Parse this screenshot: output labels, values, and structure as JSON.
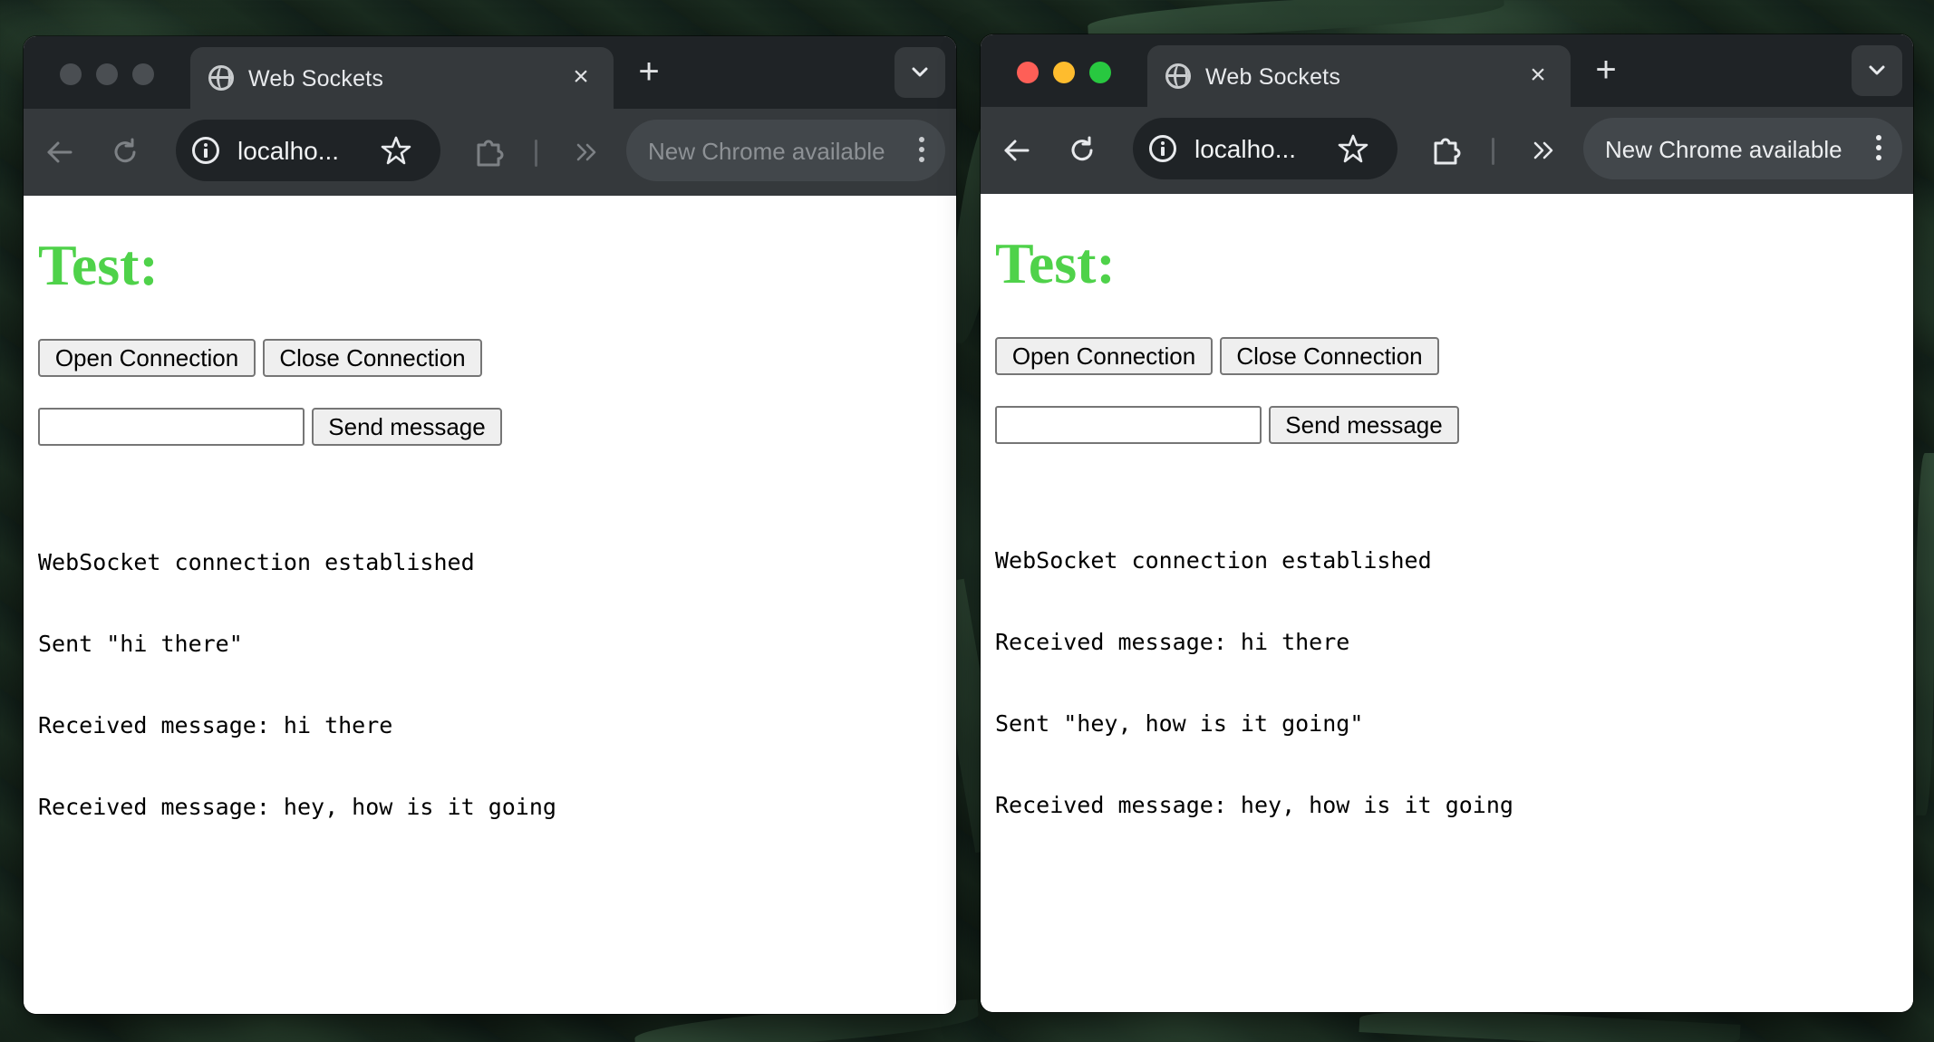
{
  "windows": [
    {
      "state": "inactive",
      "tab_title": "Web Sockets",
      "url": "localho...",
      "update_text": "New Chrome available",
      "heading": "Test:",
      "open_label": "Open Connection",
      "close_label": "Close Connection",
      "input_value": "",
      "send_label": "Send message",
      "log": [
        "WebSocket connection established",
        "Sent \"hi there\"",
        "Received message: hi there",
        "Received message: hey, how is it going"
      ]
    },
    {
      "state": "active",
      "tab_title": "Web Sockets",
      "url": "localho...",
      "update_text": "New Chrome available",
      "heading": "Test:",
      "open_label": "Open Connection",
      "close_label": "Close Connection",
      "input_value": "",
      "send_label": "Send message",
      "log": [
        "WebSocket connection established",
        "Received message: hi there",
        "Sent \"hey, how is it going\"",
        "Received message: hey, how is it going"
      ]
    }
  ],
  "icons": {
    "globe": "globe-icon",
    "close": "close-icon",
    "new_tab": "plus-icon",
    "dropdown": "chevron-down-icon",
    "back": "arrow-left-icon",
    "reload": "reload-icon",
    "info": "info-icon",
    "bookmark": "star-icon",
    "extensions": "puzzle-icon",
    "more": "double-chevron-right-icon",
    "menu": "kebab-icon"
  },
  "colors": {
    "heading_green": "#4fd24a",
    "traffic_red": "#fe5f57",
    "traffic_yellow": "#febc2e",
    "traffic_green": "#28c840",
    "tabbar": "#1f2326",
    "toolbar": "#35393c"
  }
}
